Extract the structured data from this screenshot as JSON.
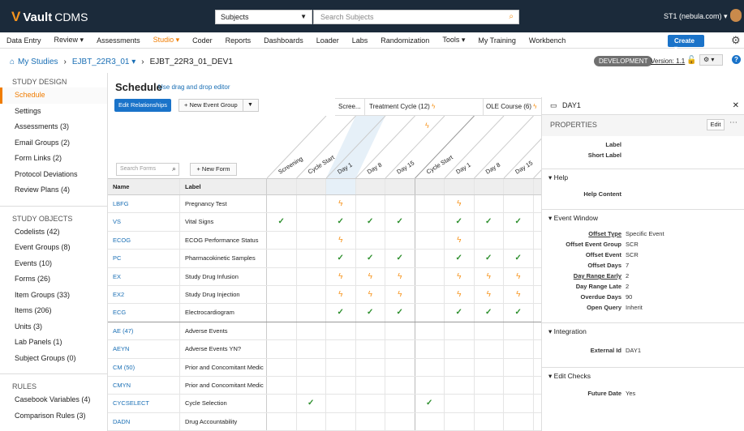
{
  "app": {
    "brand": "Vault",
    "product": "CDMS"
  },
  "topbar": {
    "subject_select": "Subjects",
    "search_placeholder": "Search Subjects",
    "user": "ST1 (nebula.com) ▾"
  },
  "nav": [
    {
      "label": "Data Entry"
    },
    {
      "label": "Review ▾"
    },
    {
      "label": "Assessments"
    },
    {
      "label": "Studio ▾"
    },
    {
      "label": "Coder"
    },
    {
      "label": "Reports"
    },
    {
      "label": "Dashboards"
    },
    {
      "label": "Loader"
    },
    {
      "label": "Labs"
    },
    {
      "label": "Randomization"
    },
    {
      "label": "Tools ▾"
    },
    {
      "label": "My Training"
    },
    {
      "label": "Workbench"
    }
  ],
  "create_label": "Create ▾",
  "breadcrumb": {
    "home": "My Studies",
    "study": "EJBT_22R3_01 ▾",
    "version": "EJBT_22R3_01_DEV1"
  },
  "status": {
    "badge": "DEVELOPMENT",
    "version": "Version: 1.1"
  },
  "sidebar": {
    "design_head": "STUDY DESIGN",
    "design_items": [
      {
        "label": "Schedule"
      },
      {
        "label": "Settings"
      },
      {
        "label": "Assessments (3)"
      },
      {
        "label": "Email Groups (2)"
      },
      {
        "label": "Form Links (2)"
      },
      {
        "label": "Protocol Deviations"
      },
      {
        "label": "Review Plans (4)"
      }
    ],
    "objects_head": "STUDY OBJECTS",
    "object_items": [
      {
        "label": "Codelists (42)"
      },
      {
        "label": "Event Groups (8)"
      },
      {
        "label": "Events (10)"
      },
      {
        "label": "Forms (26)"
      },
      {
        "label": "Item Groups (33)"
      },
      {
        "label": "Items (206)"
      },
      {
        "label": "Units (3)"
      },
      {
        "label": "Lab Panels (1)"
      },
      {
        "label": "Subject Groups (0)"
      }
    ],
    "rules_head": "RULES",
    "rule_items": [
      {
        "label": "Casebook Variables (4)"
      },
      {
        "label": "Comparison Rules (3)"
      }
    ]
  },
  "schedule": {
    "title": "Schedule",
    "hint": "Use drag and drop editor",
    "edit_relationships": "Edit Relationships",
    "new_event_group": "+ New Event Group",
    "search_forms_placeholder": "Search Forms",
    "new_form": "+ New Form",
    "groups": [
      {
        "label": "Scree...",
        "bolt": false
      },
      {
        "label": "Treatment Cycle (12)",
        "bolt": true
      },
      {
        "label": "OLE Course (6)",
        "bolt": true
      }
    ],
    "events": [
      "Screening",
      "Cycle Start",
      "Day 1",
      "Day 8",
      "Day 15",
      "Cycle Start",
      "Day 1",
      "Day 8",
      "Day 15"
    ],
    "col_name": "Name",
    "col_label": "Label",
    "rows": [
      {
        "name": "LBFG",
        "label": "Pregnancy Test",
        "cells": [
          "",
          "",
          "b",
          "",
          "",
          "",
          "b",
          "",
          ""
        ]
      },
      {
        "name": "VS",
        "label": "Vital Signs",
        "cells": [
          "c",
          "",
          "c",
          "c",
          "c",
          "",
          "c",
          "c",
          "c"
        ]
      },
      {
        "name": "ECOG",
        "label": "ECOG Performance Status",
        "cells": [
          "",
          "",
          "b",
          "",
          "",
          "",
          "b",
          "",
          ""
        ]
      },
      {
        "name": "PC",
        "label": "Pharmacokinetic Samples",
        "cells": [
          "",
          "",
          "c",
          "c",
          "c",
          "",
          "c",
          "c",
          "c"
        ]
      },
      {
        "name": "EX",
        "label": "Study Drug Infusion",
        "cells": [
          "",
          "",
          "b",
          "b",
          "b",
          "",
          "b",
          "b",
          "b"
        ]
      },
      {
        "name": "EX2",
        "label": "Study Drug Injection",
        "cells": [
          "",
          "",
          "b",
          "b",
          "b",
          "",
          "b",
          "b",
          "b"
        ]
      },
      {
        "name": "ECG",
        "label": "Electrocardiogram",
        "cells": [
          "",
          "",
          "c",
          "c",
          "c",
          "",
          "c",
          "c",
          "c"
        ]
      },
      {
        "name": "AE (47)",
        "label": "Adverse Events",
        "cells": [
          "",
          "",
          "",
          "",
          "",
          "",
          "",
          "",
          ""
        ]
      },
      {
        "name": "AEYN",
        "label": "Adverse Events YN?",
        "cells": [
          "",
          "",
          "",
          "",
          "",
          "",
          "",
          "",
          ""
        ]
      },
      {
        "name": "CM (50)",
        "label": "Prior and Concomitant Medic",
        "cells": [
          "",
          "",
          "",
          "",
          "",
          "",
          "",
          "",
          ""
        ]
      },
      {
        "name": "CMYN",
        "label": "Prior and Concomitant Medic",
        "cells": [
          "",
          "",
          "",
          "",
          "",
          "",
          "",
          "",
          ""
        ]
      },
      {
        "name": "CYCSELECT",
        "label": "Cycle Selection",
        "cells": [
          "",
          "c",
          "",
          "",
          "",
          "c",
          "",
          "",
          ""
        ]
      },
      {
        "name": "DADN",
        "label": "Drug Accountability",
        "cells": [
          "",
          "",
          "",
          "",
          "",
          "",
          "",
          "",
          ""
        ]
      }
    ]
  },
  "panel": {
    "title": "DAY1",
    "properties": "PROPERTIES",
    "edit": "Edit",
    "top_fields": [
      {
        "k": "Label",
        "v": ""
      },
      {
        "k": "Short Label",
        "v": ""
      }
    ],
    "help_head": "Help",
    "help_fields": [
      {
        "k": "Help Content",
        "v": ""
      }
    ],
    "window_head": "Event Window",
    "window_fields": [
      {
        "k": "Offset Type",
        "v": "Specific Event"
      },
      {
        "k": "Offset Event Group",
        "v": "SCR"
      },
      {
        "k": "Offset Event",
        "v": "SCR"
      },
      {
        "k": "Offset Days",
        "v": "7"
      },
      {
        "k": "Day Range Early",
        "v": "2"
      },
      {
        "k": "Day Range Late",
        "v": "2"
      },
      {
        "k": "Overdue Days",
        "v": "90"
      },
      {
        "k": "Open Query",
        "v": "Inherit"
      }
    ],
    "integration_head": "Integration",
    "integration_fields": [
      {
        "k": "External Id",
        "v": "DAY1"
      }
    ],
    "checks_head": "Edit Checks",
    "checks_fields": [
      {
        "k": "Future Date",
        "v": "Yes"
      }
    ]
  }
}
